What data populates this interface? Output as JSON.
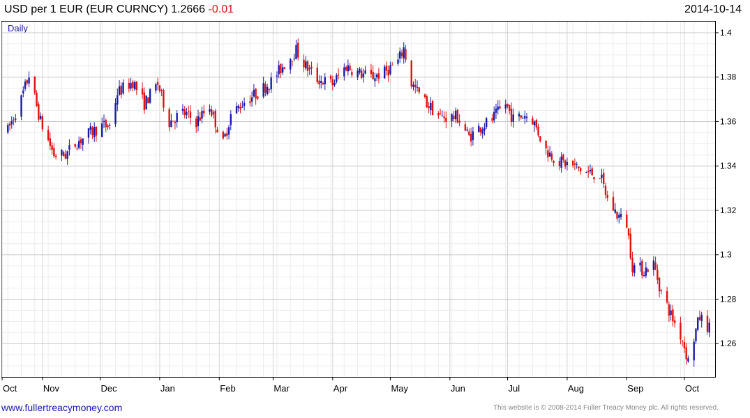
{
  "header": {
    "title": "USD per 1 EUR (EUR CURNCY) 1.2666",
    "change": "-0.01",
    "date": "2014-10-14",
    "frequency": "Daily"
  },
  "footer": {
    "website": "www.fullertreacymoney.com",
    "copyright": "This website is © 2008-2014 Fuller Treacy Money plc. All rights reserved."
  },
  "colors": {
    "up": "#1a1aaa",
    "down": "#e01010",
    "grid": "#d4d4d4",
    "text": "#000000"
  },
  "chart_data": {
    "type": "candlestick",
    "title": "USD per 1 EUR (EUR CURNCY) 1.2666",
    "ylim": [
      1.245,
      1.405
    ],
    "y_ticks": [
      1.26,
      1.28,
      1.3,
      1.32,
      1.34,
      1.36,
      1.38,
      1.4
    ],
    "y_tick_labels": [
      "1.26",
      "1.28",
      "1.3",
      "1.32",
      "1.34",
      "1.36",
      "1.38",
      "1.4"
    ],
    "x_months": [
      "Oct",
      "Nov",
      "Dec",
      "Jan",
      "Feb",
      "Mar",
      "Apr",
      "May",
      "Jun",
      "Jul",
      "Aug",
      "Sep",
      "Oct"
    ],
    "anchors": [
      [
        "2013-10-14",
        1.356
      ],
      [
        "2013-10-21",
        1.37
      ],
      [
        "2013-10-25",
        1.381
      ],
      [
        "2013-10-31",
        1.36
      ],
      [
        "2013-11-07",
        1.345
      ],
      [
        "2013-11-13",
        1.345
      ],
      [
        "2013-11-18",
        1.35
      ],
      [
        "2013-11-26",
        1.355
      ],
      [
        "2013-12-02",
        1.358
      ],
      [
        "2013-12-06",
        1.358
      ],
      [
        "2013-12-10",
        1.373
      ],
      [
        "2013-12-18",
        1.378
      ],
      [
        "2013-12-24",
        1.368
      ],
      [
        "2013-12-31",
        1.377
      ],
      [
        "2014-01-06",
        1.36
      ],
      [
        "2014-01-13",
        1.364
      ],
      [
        "2014-01-20",
        1.36
      ],
      [
        "2014-01-27",
        1.367
      ],
      [
        "2014-02-03",
        1.35
      ],
      [
        "2014-02-07",
        1.363
      ],
      [
        "2014-02-14",
        1.369
      ],
      [
        "2014-02-21",
        1.373
      ],
      [
        "2014-02-28",
        1.378
      ],
      [
        "2014-03-07",
        1.386
      ],
      [
        "2014-03-13",
        1.392
      ],
      [
        "2014-03-18",
        1.385
      ],
      [
        "2014-03-24",
        1.379
      ],
      [
        "2014-04-01",
        1.377
      ],
      [
        "2014-04-08",
        1.385
      ],
      [
        "2014-04-14",
        1.382
      ],
      [
        "2014-04-21",
        1.38
      ],
      [
        "2014-04-28",
        1.382
      ],
      [
        "2014-05-05",
        1.387
      ],
      [
        "2014-05-08",
        1.393
      ],
      [
        "2014-05-12",
        1.377
      ],
      [
        "2014-05-19",
        1.369
      ],
      [
        "2014-05-27",
        1.362
      ],
      [
        "2014-06-02",
        1.362
      ],
      [
        "2014-06-05",
        1.362
      ],
      [
        "2014-06-11",
        1.353
      ],
      [
        "2014-06-16",
        1.357
      ],
      [
        "2014-06-23",
        1.361
      ],
      [
        "2014-06-30",
        1.368
      ],
      [
        "2014-07-04",
        1.361
      ],
      [
        "2014-07-10",
        1.363
      ],
      [
        "2014-07-14",
        1.361
      ],
      [
        "2014-07-21",
        1.347
      ],
      [
        "2014-07-28",
        1.342
      ],
      [
        "2014-08-04",
        1.34
      ],
      [
        "2014-08-11",
        1.337
      ],
      [
        "2014-08-18",
        1.336
      ],
      [
        "2014-08-22",
        1.325
      ],
      [
        "2014-08-27",
        1.318
      ],
      [
        "2014-09-01",
        1.314
      ],
      [
        "2014-09-04",
        1.295
      ],
      [
        "2014-09-10",
        1.293
      ],
      [
        "2014-09-15",
        1.296
      ],
      [
        "2014-09-19",
        1.283
      ],
      [
        "2014-09-25",
        1.271
      ],
      [
        "2014-09-30",
        1.262
      ],
      [
        "2014-10-03",
        1.252
      ],
      [
        "2014-10-07",
        1.266
      ],
      [
        "2014-10-09",
        1.272
      ],
      [
        "2014-10-14",
        1.267
      ]
    ]
  }
}
